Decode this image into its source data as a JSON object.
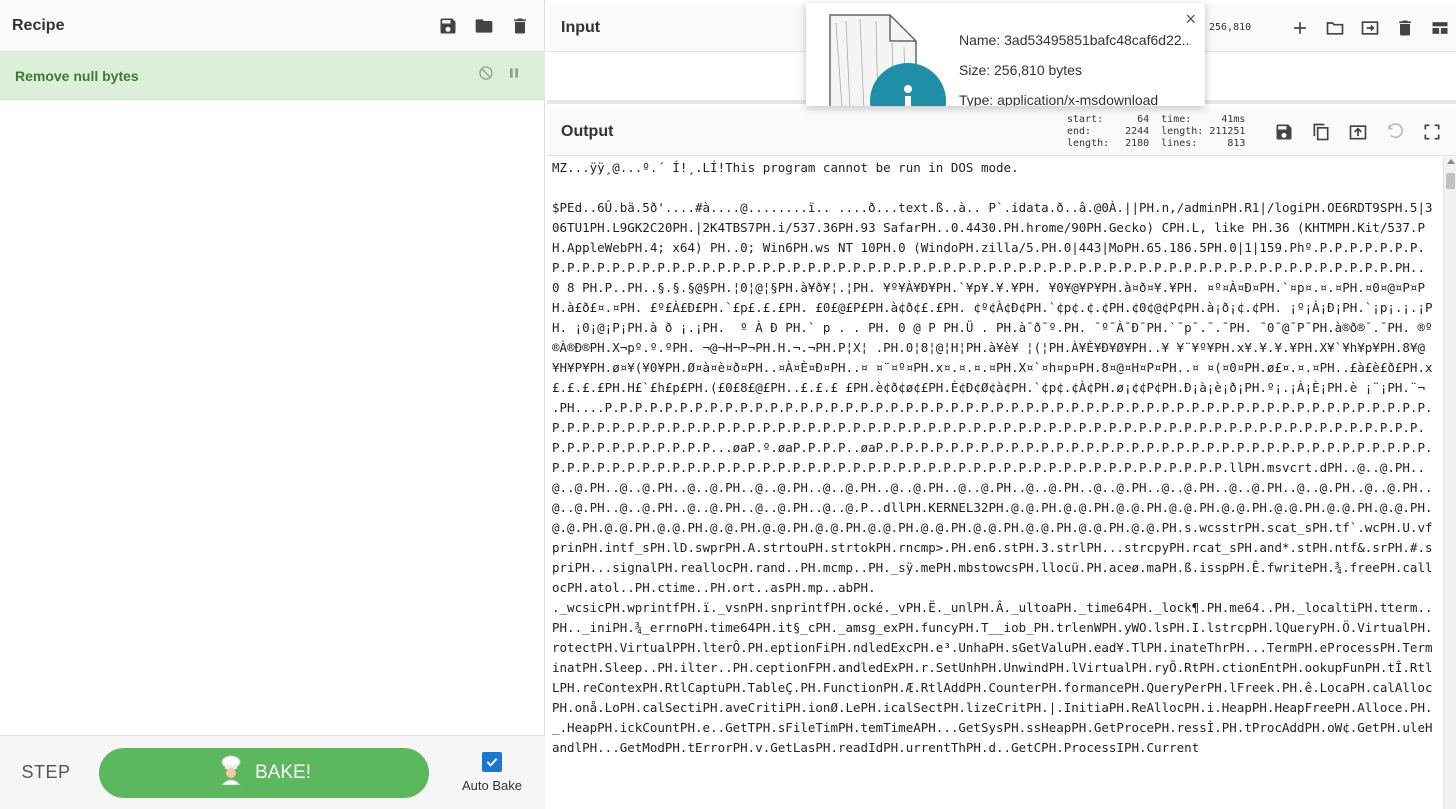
{
  "recipe": {
    "title": "Recipe",
    "operation": "Remove null bytes"
  },
  "controls": {
    "step_label": "STEP",
    "bake_label": "BAKE!",
    "auto_bake_label": "Auto Bake",
    "auto_bake_checked": true
  },
  "input": {
    "title": "Input",
    "length": "256,810"
  },
  "file_popup": {
    "name": "Name: 3ad53495851bafc48caf6d22...",
    "size": "Size: 256,810 bytes",
    "type": "Type: application/x-msdownload",
    "close": "×"
  },
  "output": {
    "title": "Output",
    "stats": {
      "start_label": "start:",
      "start": "64",
      "end_label": "end:",
      "end": "2244",
      "length_label": "length:",
      "length": "2180",
      "time_label": "time:",
      "time": "41ms",
      "olength_label": "length:",
      "olength": "211251",
      "lines_label": "lines:",
      "lines": "813"
    },
    "text": "MZ...ÿÿ¸@...º.´ Í!¸.LÍ!This program cannot be run in DOS mode.\n\n$PEd..6Û.bä.5ð'....#à....@........ï.. ....ð...text.ß..à.. P`.idata.ð..â.@0À.||PH.n,/adminPH.R1|/logiPH.OE6RDT9SPH.5|306TU1PH.L9GK2C20PH.|2K4TBS7PH.i/537.36PH.93 SafarPH..0.4430.PH.hrome/90PH.Gecko) CPH.L, like PH.36 (KHTMPH.Kit/537.PH.AppleWebPH.4; x64) PH..0; Win6PH.ws NT 10PH.0 (WindoPH.zilla/5.PH.0|443|MoPH.65.186.5PH.0|1|159.Phº.P.P.P.P.P.P.P.P.P.P.P.P.P.P.P.P.P.P.P.P.P.P.P.P.P.P.P.P.P.P.P.P.P.P.P.P.P.P.P.P.P.P.P.P.P.P.P.P.P.P.P.P.P.P.P.P.P.P.P.P.P.P.P.PH.. 0 8 PH.P..PH..§.§.§@§PH.¦0¦@¦§PH.à¥ð¥¦.¦PH. ¥º¥À¥Ð¥PH.`¥p¥.¥.¥PH. ¥0¥@¥P¥PH.à¤ð¤¥.¥PH. ¤º¤À¤Ð¤PH.`¤p¤.¤.¤PH.¤0¤@¤P¤PH.à£ð£¤.¤PH. £º£À£Ð£PH.`£p£.£.£PH. £0£@£P£PH.à¢ð¢£.£PH. ¢º¢À¢Ð¢PH.`¢p¢.¢.¢PH.¢0¢@¢P¢PH.à¡ð¡¢.¢PH. ¡º¡À¡Ð¡PH.`¡p¡.¡.¡PH. ¡0¡@¡P¡PH.à ð ¡.¡PH.  º À Ð PH.` p . . PH. 0 @ P PH.Ü . PH.à¯ð¯º.PH. ¯º¯À¯Ð¯PH.`¯p¯.¯.¯PH. ¯0¯@¯P¯PH.à®ð®¯.¯PH. ®º®À®Ð®PH.X¬pº.º.ºPH. ¬@¬H¬P¬PH.H.¬.¬PH.P¦X¦ .PH.0¦8¦@¦H¦PH.à¥è¥ ¦(¦PH.À¥È¥Ð¥Ø¥PH..¥ ¥¨¥º¥PH.x¥.¥.¥.¥PH.X¥`¥h¥p¥PH.8¥@¥H¥P¥PH.ø¤¥(¥0¥PH.Ø¤à¤è¤ð¤PH..¤À¤È¤Ð¤PH..¤ ¤¨¤º¤PH.x¤.¤.¤.¤PH.X¤`¤h¤p¤PH.8¤@¤H¤P¤PH..¤ ¤(¤0¤PH.ø£¤.¤.¤PH..£à£è£ð£PH.x£.£.£.£PH.H£`£h£p£PH.(£0£8£@£PH..£.£.£ £PH.è¢ð¢ø¢£PH.È¢Ð¢Ø¢à¢PH.`¢p¢.¢À¢PH.ø¡¢¢P¢PH.Ð¡à¡è¡ð¡PH.º¡.¡À¡È¡PH.è ¡¨¡PH.¨¬\n.PH....P.P.P.P.P.P.P.P.P.P.P.P.P.P.P.P.P.P.P.P.P.P.P.P.P.P.P.P.P.P.P.P.P.P.P.P.P.P.P.P.P.P.P.P.P.P.P.P.P.P.P.P.P.P.P.P.P.P.P.P.P.P.P.P.P.P.P.P.P.P.P.P.P.P.P.P.P.P.P.P.P.P.P.P.P.P.P.P.P.P.P.P.P.P.P.P.P.P.P.P.P.P.P.P.P.P.P.P.P.P.P.P.P.P.P.P.P.P.P.P.P.P.P.P...øaP.º.øaP.P.P.P..øaP.P.P.P.P.P.P.P.P.P.P.P.P.P.P.P.P.P.P.P.P.P.P.P.P.P.P.P.P.P.P.P.P.P.P.P.P.P.P.P.P.P.P.P.P.P.P.P.P.P.P.P.P.P.P.P.P.P.P.P.P.P.P.P.P.P.P.P.P.P.P.P.P.P.P.P.P.P.P.P.P.P.llPH.msvcrt.dPH..@..@.PH..@..@.PH..@..@.PH..@..@.PH..@..@.PH..@..@.PH..@..@.PH..@..@.PH..@..@.PH..@..@.PH..@..@.PH..@..@.PH..@..@.PH..@..@.PH..@..@.PH..@..@.PH..@..@.PH..@..@.PH..@..@.P..dllPH.KERNEL32PH.@.@.PH.@.@.PH.@.@.PH.@.@.PH.@.@.PH.@.@.PH.@.@.PH.@.@.PH.@.@.PH.@.@.PH.@.@.PH.@.@.PH.@.@.PH.@.@.PH.@.@.PH.@.@.PH.@.@.PH.@.@.PH.@.@.PH.@.@.PH.s.wcsstrPH.scat_sPH.tf`.wcPH.U.vfprinPH.intf_sPH.lD.swprPH.A.strtouPH.strtokPH.rncmp>.PH.en6.stPH.3.strlPH...strcpyPH.rcat_sPH.and*.stPH.ntf&.srPH.#.spriPH...signalPH.reallocPH.rand..PH.mcmp..PH._sÿ.mePH.mbstowcsPH.llocü.PH.aceø.maPH.ß.isspPH.Ê.fwritePH.¾.freePH.callocPH.atol..PH.ctime..PH.ort..asPH.mp..abPH.\n._wcsicPH.wprintfPH.ï._vsnPH.snprintfPH.ocké._vPH.Ë._unlPH.Â._ultoaPH._time64PH._lock¶.PH.me64..PH._localtiPH.tterm..PH.._iniPH.¾_errnoPH.time64PH.it§_cPH._amsg_exPH.funcyPH.T__iob_PH.trlenWPH.yWO.lsPH.I.lstrcpPH.lQueryPH.Ö.VirtualPH.rotectPH.VirtualPPH.lterÔ.PH.eptionFiPH.ndledExcPH.e³.UnhaPH.sGetValuPH.ead¥.TlPH.inateThrPH...TermPH.eProcessPH.TerminatPH.Sleep..PH.ilter..PH.ceptionFPH.andledExPH.r.SetUnhPH.UnwindPH.lVirtualPH.ryÕ.RtPH.ctionEntPH.ookupFunPH.tÎ.RtlLPH.reContexPH.RtlCaptuPH.TableÇ.PH.FunctionPH.Æ.RtlAddPH.CounterPH.formancePH.QueryPerPH.lFreek.PH.ê.LocaPH.calAllocPH.onå.LoPH.calSectiPH.aveCritiPH.ionØ.LePH.icalSectPH.lizeCritPH.|.InitiaPH.ReAllocPH.i.HeapPH.HeapFreePH.Alloce.PH._.HeapPH.ickCountPH.e..GetTPH.sFileTimPH.temTimeAPH...GetSysPH.ssHeapPH.GetProcePH.ressÌ.PH.tProcAddPH.oW¢.GetPH.uleHandlPH...GetModPH.tErrorPH.v.GetLasPH.readIdPH.urrentThPH.d..GetCPH.ProcessIPH.Current"
  }
}
